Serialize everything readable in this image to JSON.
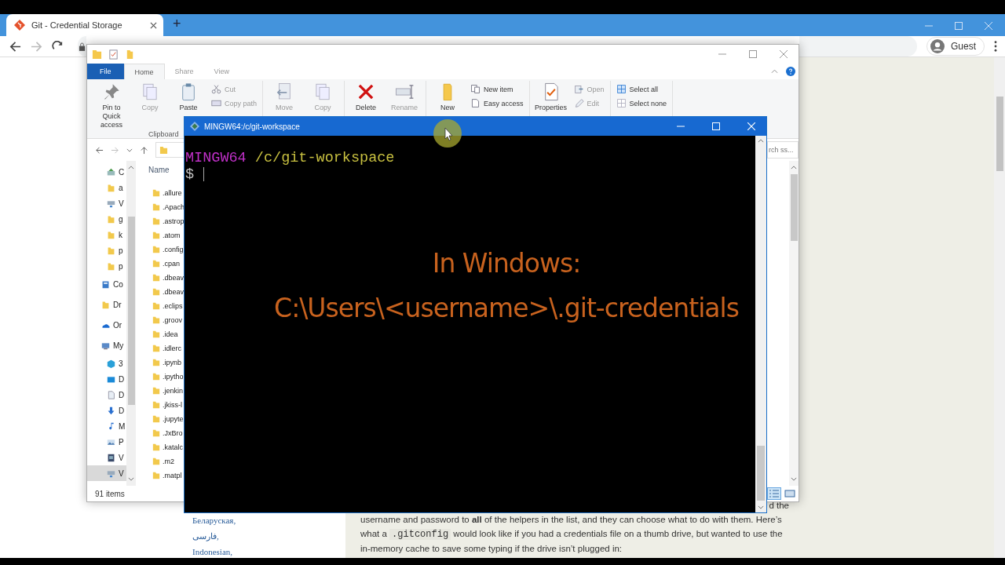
{
  "browser": {
    "tab_title": "Git - Credential Storage",
    "new_tab": "+",
    "forward_disabled": true,
    "profile": "Guest"
  },
  "page": {
    "languages": [
      "Беларуская,",
      "فارسی,",
      "Indonesian,"
    ],
    "paragraph": [
      {
        "parts": [
          "d the"
        ]
      },
      {
        "parts": [
          "username and password to **all** of the helpers in the list, and they can choose what to do with them. Here’s"
        ]
      },
      {
        "parts": [
          "what a ",
          ".gitconfig",
          " would look like if you had a credentials file on a thumb drive, but wanted to use the"
        ]
      },
      {
        "parts": [
          "in-memory cache to save some typing if the drive isn’t plugged in:"
        ]
      }
    ]
  },
  "explorer": {
    "ribbon_tabs": [
      {
        "label": "File",
        "selected": false
      },
      {
        "label": "Home",
        "selected": true
      },
      {
        "label": "Share",
        "selected": false
      },
      {
        "label": "View",
        "selected": false
      }
    ],
    "ribbon_groups": [
      {
        "label": "Clipboard",
        "items": [
          {
            "label": "Pin to Quick access",
            "kind": "pin",
            "disabled": false
          },
          {
            "label": "Copy",
            "kind": "copy",
            "disabled": true
          },
          {
            "label": "Paste",
            "kind": "paste",
            "disabled": false
          },
          {
            "label": "Cut",
            "kind": "cut",
            "disabled": true
          },
          {
            "label": "Copy path",
            "kind": "copy-path",
            "disabled": true
          }
        ]
      },
      {
        "items": [
          {
            "label": "Move",
            "kind": "move",
            "disabled": true
          },
          {
            "label": "Copy",
            "kind": "copy",
            "disabled": true
          }
        ]
      },
      {
        "items": [
          {
            "label": "Delete",
            "kind": "delete",
            "disabled": false
          },
          {
            "label": "Rename",
            "kind": "rename",
            "disabled": true
          }
        ]
      },
      {
        "items": [
          {
            "label": "New",
            "kind": "new-folder",
            "disabled": false
          },
          {
            "label": "New item",
            "kind": "new-item",
            "disabled": false
          },
          {
            "label": "Easy access",
            "kind": "easy-access",
            "disabled": false
          }
        ]
      },
      {
        "items": [
          {
            "label": "Properties",
            "kind": "properties",
            "disabled": false
          },
          {
            "label": "Open",
            "kind": "open",
            "disabled": true
          },
          {
            "label": "Edit",
            "kind": "edit",
            "disabled": true
          }
        ]
      },
      {
        "items": [
          {
            "label": "Select all",
            "kind": "select-all",
            "disabled": false
          },
          {
            "label": "Select none",
            "kind": "select-none",
            "disabled": false
          }
        ]
      }
    ],
    "search_placeholder": "rch ss...",
    "sidebar": {
      "pinned": [
        {
          "label": "C",
          "kind": "drive",
          "selected": false
        },
        {
          "label": "a",
          "kind": "folder",
          "selected": false
        },
        {
          "label": "V",
          "kind": "network",
          "selected": false
        },
        {
          "label": "g",
          "kind": "folder",
          "selected": false
        },
        {
          "label": "k",
          "kind": "folder",
          "selected": false
        },
        {
          "label": "p",
          "kind": "folder",
          "selected": false
        },
        {
          "label": "p",
          "kind": "folder",
          "selected": false
        }
      ],
      "items": [
        {
          "label": "Co",
          "kind": "library",
          "selected": false
        },
        {
          "label": "Dr",
          "kind": "folder",
          "selected": false
        },
        {
          "label": "Or",
          "kind": "cloud",
          "selected": false
        },
        {
          "label": "My",
          "kind": "pc",
          "selected": false,
          "children": [
            {
              "label": "3",
              "kind": "cube",
              "selected": false
            },
            {
              "label": "D",
              "kind": "desktop",
              "selected": false
            },
            {
              "label": "D",
              "kind": "documents",
              "selected": false
            },
            {
              "label": "D",
              "kind": "downloads",
              "selected": false
            },
            {
              "label": "M",
              "kind": "music",
              "selected": false
            },
            {
              "label": "P",
              "kind": "pictures",
              "selected": false
            },
            {
              "label": "V",
              "kind": "videos",
              "selected": false
            },
            {
              "label": "V",
              "kind": "network",
              "selected": true
            }
          ]
        }
      ]
    },
    "column_header": "Name",
    "files": [
      ".allure",
      ".Apach",
      ".astrop",
      ".atom",
      ".config",
      ".cpan",
      ".dbeav",
      ".dbeav",
      ".eclips",
      ".groov",
      ".idea",
      ".idlerc",
      ".ipynb",
      ".ipytho",
      ".jenkin",
      ".jkiss-l",
      ".jupyte",
      ".JxBro",
      ".katalc",
      ".m2",
      ".matpl"
    ],
    "status": "91 items",
    "view_buttons": [
      {
        "kind": "details",
        "selected": true
      },
      {
        "kind": "large-icons",
        "selected": false
      }
    ]
  },
  "terminal": {
    "title": "MINGW64:/c/git-workspace",
    "host": "MINGW64",
    "path": "/c/git-workspace",
    "prompt": "$"
  },
  "caption": [
    "In Windows:",
    "C:\\Users\\<username>\\.git-credentials"
  ]
}
